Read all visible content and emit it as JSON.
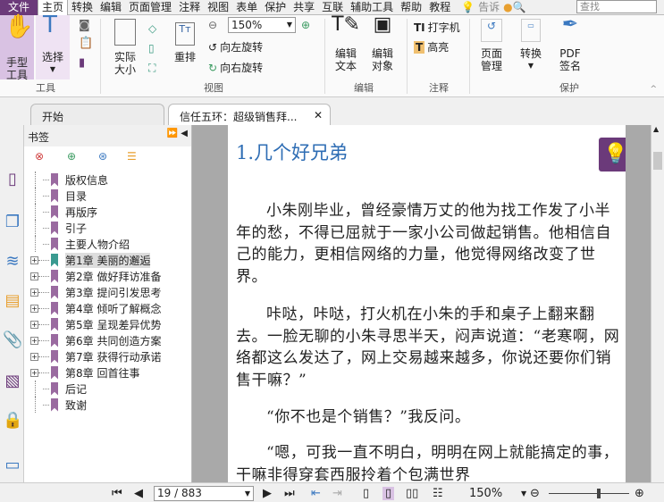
{
  "menu": {
    "file": "文件",
    "items": [
      "主页",
      "转换",
      "编辑",
      "页面管理",
      "注释",
      "视图",
      "表单",
      "保护",
      "共享",
      "互联",
      "辅助工具",
      "帮助",
      "教程"
    ],
    "tell": "告诉",
    "search_placeholder": "查找"
  },
  "ribbon": {
    "hand": "手型\n工具",
    "select": "选择",
    "tools_group": "工具",
    "actual_size": "实际\n大小",
    "reflow": "重排",
    "zoom_value": "150%",
    "rotate_left": "向左旋转",
    "rotate_right": "向右旋转",
    "view_group": "视图",
    "edit_text": "编辑\n文本",
    "edit_object": "编辑\n对象",
    "edit_group": "编辑",
    "typewriter": "打字机",
    "highlight": "高亮",
    "comment_group": "注释",
    "page_manage": "页面\n管理",
    "convert": "转换",
    "pdf_sign": "PDF\n签名",
    "protect_group": "保护"
  },
  "tabs": {
    "start": "开始",
    "doc": "信任五环：超级销售拜..."
  },
  "bookmarks": {
    "title": "书签",
    "items": [
      {
        "label": "版权信息",
        "expandable": false
      },
      {
        "label": "目录",
        "expandable": false
      },
      {
        "label": "再版序",
        "expandable": false
      },
      {
        "label": "引子",
        "expandable": false
      },
      {
        "label": "主要人物介绍",
        "expandable": false
      },
      {
        "label": "第1章 美丽的邂逅",
        "expandable": true,
        "selected": true
      },
      {
        "label": "第2章 做好拜访准备",
        "expandable": true
      },
      {
        "label": "第3章 提问引发思考",
        "expandable": true
      },
      {
        "label": "第4章 倾听了解概念",
        "expandable": true
      },
      {
        "label": "第5章 呈现差异优势",
        "expandable": true
      },
      {
        "label": "第6章 共同创造方案",
        "expandable": true
      },
      {
        "label": "第7章 获得行动承诺",
        "expandable": true
      },
      {
        "label": "第8章 回首往事",
        "expandable": true
      },
      {
        "label": "后记",
        "expandable": false
      },
      {
        "label": "致谢",
        "expandable": false
      }
    ]
  },
  "document": {
    "heading": "1.几个好兄弟",
    "paragraphs": [
      "小朱刚毕业，曾经豪情万丈的他为找工作发了小半年的愁，不得已屈就于一家小公司做起销售。他相信自己的能力，更相信网络的力量，他觉得网络改变了世界。",
      "咔哒，咔哒，打火机在小朱的手和桌子上翻来翻去。一脸无聊的小朱寻思半天，闷声说道：“老寒啊，网络都这么发达了，网上交易越来越多，你说还要你们销售干嘛？”",
      "“你不也是个销售？”我反问。",
      "“嗯，可我一直不明白，明明在网上就能搞定的事，干嘛非得穿套西服拎着个包满世界"
    ]
  },
  "status": {
    "page": "19 / 883",
    "zoom": "150%",
    "zoom_fraction": 0.6
  },
  "colors": {
    "accent": "#6b3a7a",
    "bookmark": "#9a6aa0",
    "selected_bookmark": "#3a9a90",
    "heading": "#2e6db4"
  }
}
